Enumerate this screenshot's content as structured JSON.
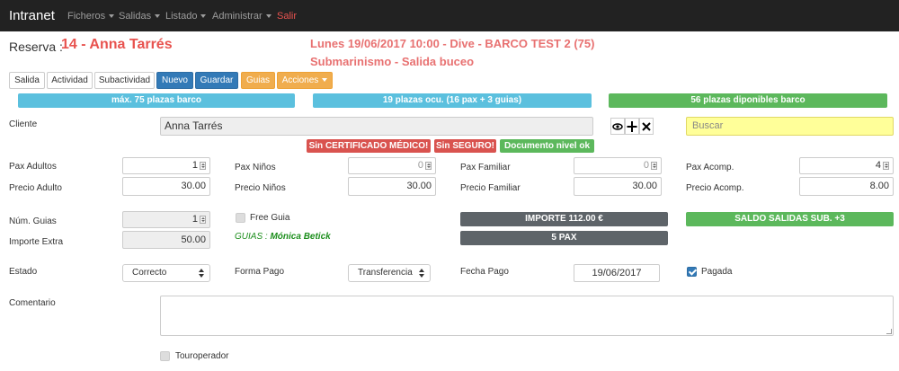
{
  "navbar": {
    "brand": "Intranet",
    "items": [
      {
        "label": "Ficheros"
      },
      {
        "label": "Salidas"
      },
      {
        "label": "Listado"
      },
      {
        "label": "Administrar"
      }
    ],
    "logout": "Salir"
  },
  "header": {
    "reserva_label": "Reserva :",
    "reserva_name": "14 - Anna Tarrés",
    "event_line1": "Lunes 19/06/2017 10:00 - Dive - BARCO TEST 2 (75)",
    "event_line2": "Submarinismo - Salida buceo"
  },
  "toolbar": {
    "salida": "Salida",
    "actividad": "Actividad",
    "subactividad": "Subactividad",
    "nuevo": "Nuevo",
    "guardar": "Guardar",
    "guias": "Guias",
    "acciones": "Acciones"
  },
  "capacity": {
    "max": "máx. 75 plazas barco",
    "ocupadas": "19 plazas ocu. (16 pax + 3 guias)",
    "disponibles": "56 plazas diponibles barco"
  },
  "cliente": {
    "label": "Cliente",
    "value": "Anna Tarrés",
    "search_placeholder": "Buscar",
    "badges": {
      "certificado": "Sin CERTIFICADO MÉDICO!",
      "seguro": "Sin SEGURO!",
      "documento": "Documento nivel ok"
    }
  },
  "pax": {
    "adultos_label": "Pax Adultos",
    "adultos_value": "1",
    "ninos_label": "Pax Niños",
    "ninos_value": "0",
    "familiar_label": "Pax Familiar",
    "familiar_value": "0",
    "acomp_label": "Pax Acomp.",
    "acomp_value": "4"
  },
  "precio": {
    "adulto_label": "Precio Adulto",
    "adulto_value": "30.00",
    "ninos_label": "Precio Niños",
    "ninos_value": "30.00",
    "familiar_label": "Precio Familiar",
    "familiar_value": "30.00",
    "acomp_label": "Precio Acomp.",
    "acomp_value": "8.00"
  },
  "guias": {
    "num_label": "Núm. Guias",
    "num_value": "1",
    "free_label": "Free Guia",
    "extra_label": "Importe Extra",
    "extra_value": "50.00",
    "guias_prefix": "GUIAS :",
    "guias_name": "Mónica Betick"
  },
  "totals": {
    "importe": "IMPORTE 112.00 €",
    "pax": "5 PAX",
    "saldo": "SALDO SALIDAS SUB. +3"
  },
  "payment": {
    "estado_label": "Estado",
    "estado_value": "Correcto",
    "forma_label": "Forma Pago",
    "forma_value": "Transferencia",
    "fecha_label": "Fecha Pago",
    "fecha_value": "19/06/2017",
    "pagada_label": "Pagada",
    "pagada_checked": true
  },
  "comentario_label": "Comentario",
  "touroperador_label": "Touroperador",
  "colors": {
    "navbar": "#222222",
    "accent_red": "#e8534f",
    "primary": "#337ab7",
    "warning": "#f0ad4e",
    "info": "#5bc0de",
    "success": "#5cb85c",
    "danger": "#d9534f"
  }
}
